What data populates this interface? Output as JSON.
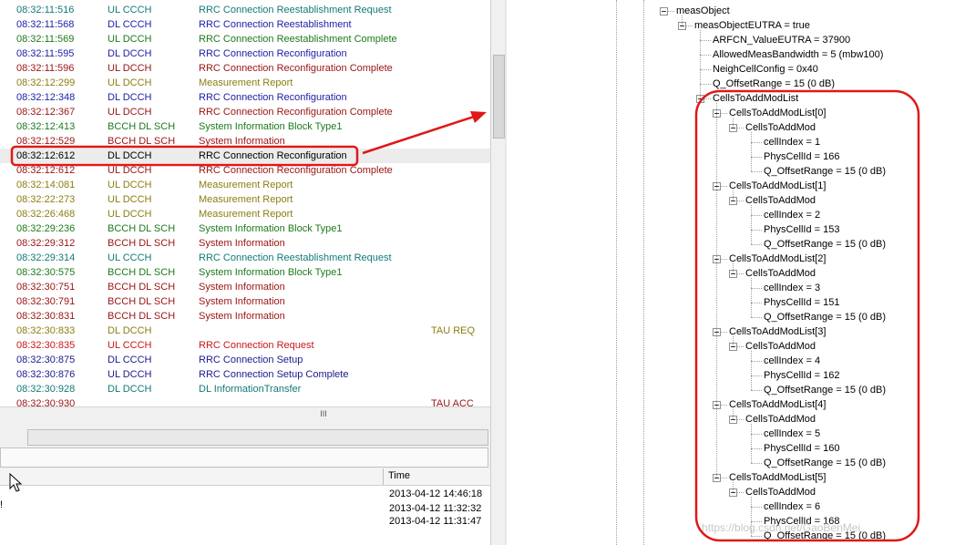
{
  "log": {
    "rows": [
      {
        "time": "08:32:11:516",
        "channel": "UL CCCH",
        "message": "RRC Connection Reestablishment Request",
        "color": "teal"
      },
      {
        "time": "08:32:11:568",
        "channel": "DL CCCH",
        "message": "RRC Connection Reestablishment",
        "color": "blue"
      },
      {
        "time": "08:32:11:569",
        "channel": "UL DCCH",
        "message": "RRC Connection Reestablishment Complete",
        "color": "green"
      },
      {
        "time": "08:32:11:595",
        "channel": "DL DCCH",
        "message": "RRC Connection Reconfiguration",
        "color": "blue"
      },
      {
        "time": "08:32:11:596",
        "channel": "UL DCCH",
        "message": "RRC Connection Reconfiguration Complete",
        "color": "red"
      },
      {
        "time": "08:32:12:299",
        "channel": "UL DCCH",
        "message": "Measurement Report",
        "color": "olive"
      },
      {
        "time": "08:32:12:348",
        "channel": "DL DCCH",
        "message": "RRC Connection Reconfiguration",
        "color": "blue"
      },
      {
        "time": "08:32:12:367",
        "channel": "UL DCCH",
        "message": "RRC Connection Reconfiguration Complete",
        "color": "red"
      },
      {
        "time": "08:32:12:413",
        "channel": "BCCH DL SCH",
        "message": "System Information Block Type1",
        "color": "green"
      },
      {
        "time": "08:32:12:529",
        "channel": "BCCH DL SCH",
        "message": "System Information",
        "color": "red"
      },
      {
        "time": "08:32:12:612",
        "channel": "DL DCCH",
        "message": "RRC Connection Reconfiguration",
        "color": "plain",
        "selected": true
      },
      {
        "time": "08:32:12:612",
        "channel": "UL DCCH",
        "message": "RRC Connection Reconfiguration Complete",
        "color": "red"
      },
      {
        "time": "08:32:14:081",
        "channel": "UL DCCH",
        "message": "Measurement Report",
        "color": "olive"
      },
      {
        "time": "08:32:22:273",
        "channel": "UL DCCH",
        "message": "Measurement Report",
        "color": "olive"
      },
      {
        "time": "08:32:26:468",
        "channel": "UL DCCH",
        "message": "Measurement Report",
        "color": "olive"
      },
      {
        "time": "08:32:29:236",
        "channel": "BCCH DL SCH",
        "message": "System Information Block Type1",
        "color": "green"
      },
      {
        "time": "08:32:29:312",
        "channel": "BCCH DL SCH",
        "message": "System Information",
        "color": "red"
      },
      {
        "time": "08:32:29:314",
        "channel": "UL CCCH",
        "message": "RRC Connection Reestablishment Request",
        "color": "teal"
      },
      {
        "time": "08:32:30:575",
        "channel": "BCCH DL SCH",
        "message": "System Information Block Type1",
        "color": "green"
      },
      {
        "time": "08:32:30:751",
        "channel": "BCCH DL SCH",
        "message": "System Information",
        "color": "red"
      },
      {
        "time": "08:32:30:791",
        "channel": "BCCH DL SCH",
        "message": "System Information",
        "color": "red"
      },
      {
        "time": "08:32:30:831",
        "channel": "BCCH DL SCH",
        "message": "System Information",
        "color": "red"
      },
      {
        "time": "08:32:30:833",
        "channel": "DL DCCH",
        "message": "",
        "note": "TAU REQ",
        "color": "olive"
      },
      {
        "time": "08:32:30:835",
        "channel": "UL CCCH",
        "message": "RRC Connection Request",
        "color": "brightred"
      },
      {
        "time": "08:32:30:875",
        "channel": "DL CCCH",
        "message": "RRC Connection Setup",
        "color": "navy"
      },
      {
        "time": "08:32:30:876",
        "channel": "UL DCCH",
        "message": "RRC Connection Setup Complete",
        "color": "navy"
      },
      {
        "time": "08:32:30:928",
        "channel": "DL DCCH",
        "message": "DL InformationTransfer",
        "color": "teal"
      },
      {
        "time": "08:32:30:930",
        "channel": "",
        "message": "",
        "note": "TAU ACC",
        "color": "red"
      }
    ],
    "scroll_grip": "III"
  },
  "bottom": {
    "time_header": "Time",
    "times": [
      "2013-04-12 14:46:18",
      "2013-04-12 11:32:32",
      "2013-04-12 11:31:47"
    ],
    "fragment": "!"
  },
  "tree": {
    "nodes": [
      {
        "text": "measObject",
        "depth": 0
      },
      {
        "text": "measObjectEUTRA = true",
        "depth": 1
      },
      {
        "text": "ARFCN_ValueEUTRA = 37900",
        "depth": 2
      },
      {
        "text": "AllowedMeasBandwidth = 5 (mbw100)",
        "depth": 2
      },
      {
        "text": "NeighCellConfig = 0x40",
        "depth": 2
      },
      {
        "text": "Q_OffsetRange = 15 (0 dB)",
        "depth": 2
      },
      {
        "text": "CellsToAddModList",
        "depth": 2
      },
      {
        "text": "CellsToAddModList[0]",
        "depth": 3
      },
      {
        "text": "CellsToAddMod",
        "depth": 4
      },
      {
        "text": "cellIndex = 1",
        "depth": 5
      },
      {
        "text": "PhysCellId = 166",
        "depth": 5
      },
      {
        "text": "Q_OffsetRange = 15 (0 dB)",
        "depth": 5
      },
      {
        "text": "CellsToAddModList[1]",
        "depth": 3
      },
      {
        "text": "CellsToAddMod",
        "depth": 4
      },
      {
        "text": "cellIndex = 2",
        "depth": 5
      },
      {
        "text": "PhysCellId = 153",
        "depth": 5
      },
      {
        "text": "Q_OffsetRange = 15 (0 dB)",
        "depth": 5
      },
      {
        "text": "CellsToAddModList[2]",
        "depth": 3
      },
      {
        "text": "CellsToAddMod",
        "depth": 4
      },
      {
        "text": "cellIndex = 3",
        "depth": 5
      },
      {
        "text": "PhysCellId = 151",
        "depth": 5
      },
      {
        "text": "Q_OffsetRange = 15 (0 dB)",
        "depth": 5
      },
      {
        "text": "CellsToAddModList[3]",
        "depth": 3
      },
      {
        "text": "CellsToAddMod",
        "depth": 4
      },
      {
        "text": "cellIndex = 4",
        "depth": 5
      },
      {
        "text": "PhysCellId = 162",
        "depth": 5
      },
      {
        "text": "Q_OffsetRange = 15 (0 dB)",
        "depth": 5
      },
      {
        "text": "CellsToAddModList[4]",
        "depth": 3
      },
      {
        "text": "CellsToAddMod",
        "depth": 4
      },
      {
        "text": "cellIndex = 5",
        "depth": 5
      },
      {
        "text": "PhysCellId = 160",
        "depth": 5
      },
      {
        "text": "Q_OffsetRange = 15 (0 dB)",
        "depth": 5
      },
      {
        "text": "CellsToAddModList[5]",
        "depth": 3
      },
      {
        "text": "CellsToAddMod",
        "depth": 4
      },
      {
        "text": "cellIndex = 6",
        "depth": 5
      },
      {
        "text": "PhysCellId = 168",
        "depth": 5
      },
      {
        "text": "Q_OffsetRange = 15 (0 dB)",
        "depth": 5
      }
    ]
  },
  "watermark": "https://blog.csdn.net/GaoBenMei",
  "annotation_color": "#e01818"
}
